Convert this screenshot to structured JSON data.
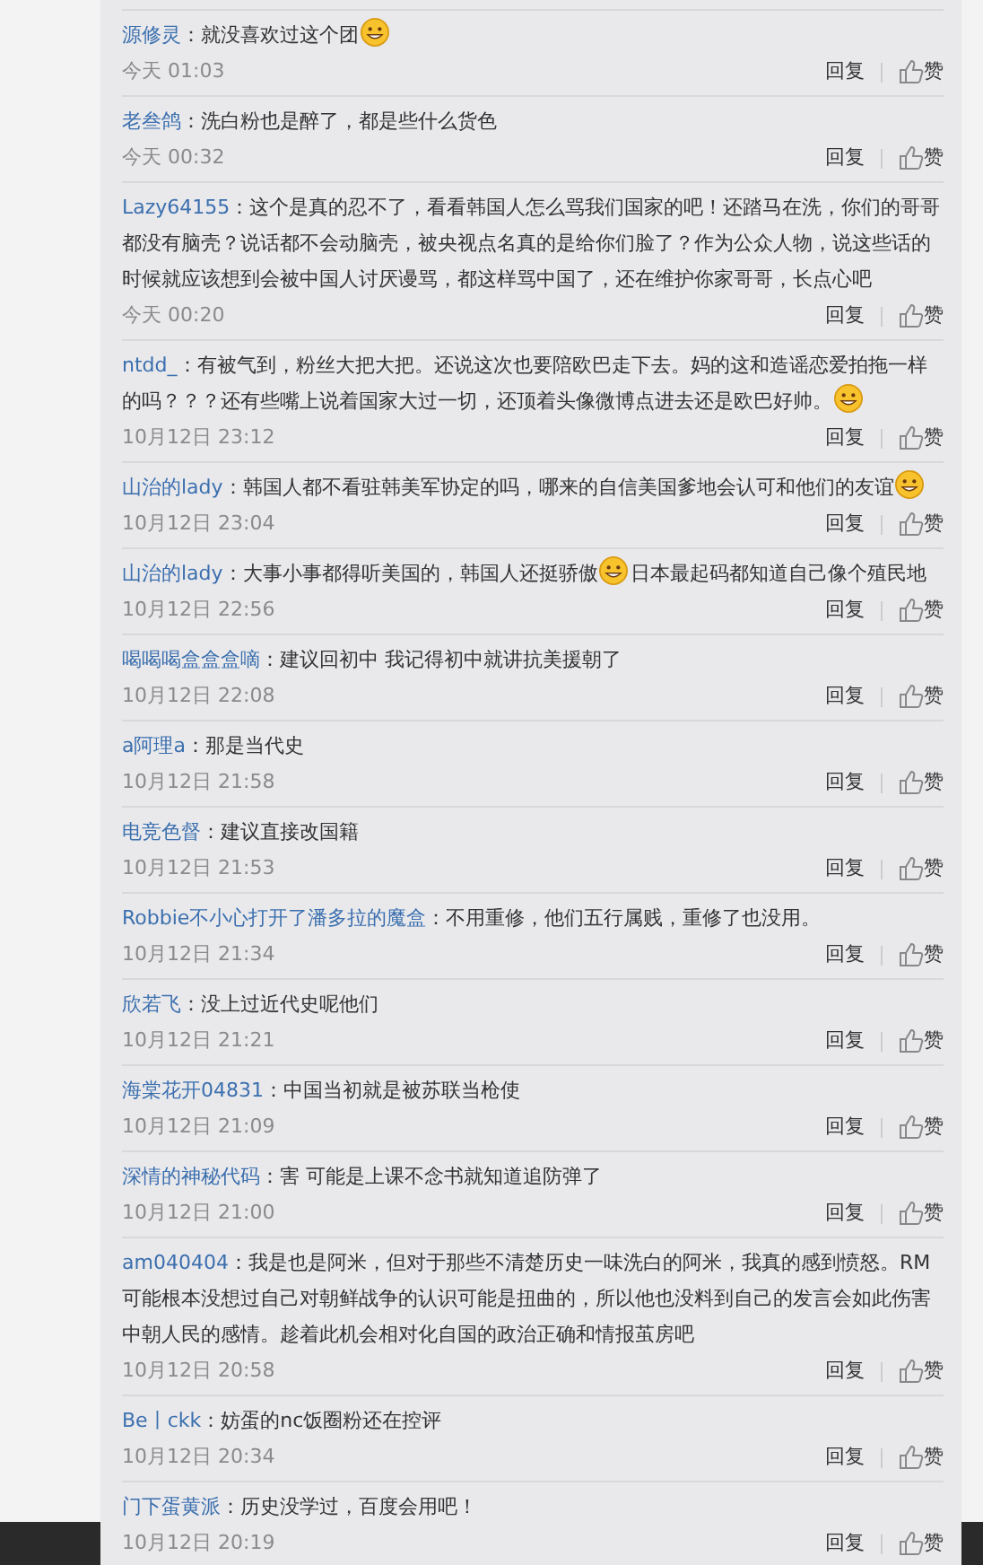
{
  "comments": [
    {
      "user": "源修灵",
      "segments": [
        {
          "kind": "text",
          "text": "：就没喜欢过这个团"
        },
        {
          "kind": "emoji"
        }
      ],
      "time": "今天 01:03",
      "reply": "回复",
      "like": "赞"
    },
    {
      "user": "老叁鸽",
      "segments": [
        {
          "kind": "text",
          "text": "：洗白粉也是醉了，都是些什么货色"
        }
      ],
      "time": "今天 00:32",
      "reply": "回复",
      "like": "赞"
    },
    {
      "user": "Lazy64155",
      "segments": [
        {
          "kind": "text",
          "text": "：这个是真的忍不了，看看韩国人怎么骂我们国家的吧！还踏马在洗，你们的哥哥都没有脑壳？说话都不会动脑壳，被央视点名真的是给你们脸了？作为公众人物，说这些话的时候就应该想到会被中国人讨厌谩骂，都这样骂中国了，还在维护你家哥哥，长点心吧"
        }
      ],
      "time": "今天 00:20",
      "reply": "回复",
      "like": "赞"
    },
    {
      "user": "ntdd_",
      "segments": [
        {
          "kind": "text",
          "text": "：有被气到，粉丝大把大把。还说这次也要陪欧巴走下去。妈的这和造谣恋爱拍拖一样的吗？？？还有些嘴上说着国家大过一切，还顶着头像微博点进去还是欧巴好帅。"
        },
        {
          "kind": "emoji"
        }
      ],
      "time": "10月12日 23:12",
      "reply": "回复",
      "like": "赞"
    },
    {
      "user": "山治的lady",
      "segments": [
        {
          "kind": "text",
          "text": "：韩国人都不看驻韩美军协定的吗，哪来的自信美国爹地会认可和他们的友谊"
        },
        {
          "kind": "emoji"
        }
      ],
      "time": "10月12日 23:04",
      "reply": "回复",
      "like": "赞"
    },
    {
      "user": "山治的lady",
      "segments": [
        {
          "kind": "text",
          "text": "：大事小事都得听美国的，韩国人还挺骄傲"
        },
        {
          "kind": "emoji"
        },
        {
          "kind": "text",
          "text": "日本最起码都知道自己像个殖民地"
        }
      ],
      "time": "10月12日 22:56",
      "reply": "回复",
      "like": "赞"
    },
    {
      "user": "喝喝喝盒盒盒嘀",
      "segments": [
        {
          "kind": "text",
          "text": "：建议回初中 我记得初中就讲抗美援朝了"
        }
      ],
      "time": "10月12日 22:08",
      "reply": "回复",
      "like": "赞"
    },
    {
      "user": "a阿理a",
      "segments": [
        {
          "kind": "text",
          "text": "：那是当代史"
        }
      ],
      "time": "10月12日 21:58",
      "reply": "回复",
      "like": "赞"
    },
    {
      "user": "电竞色督",
      "segments": [
        {
          "kind": "text",
          "text": "：建议直接改国籍"
        }
      ],
      "time": "10月12日 21:53",
      "reply": "回复",
      "like": "赞"
    },
    {
      "user": "Robbie不小心打开了潘多拉的魔盒",
      "segments": [
        {
          "kind": "text",
          "text": "：不用重修，他们五行属贱，重修了也没用。"
        }
      ],
      "time": "10月12日 21:34",
      "reply": "回复",
      "like": "赞"
    },
    {
      "user": "欣若飞",
      "segments": [
        {
          "kind": "text",
          "text": "：没上过近代史呢他们"
        }
      ],
      "time": "10月12日 21:21",
      "reply": "回复",
      "like": "赞"
    },
    {
      "user": "海棠花开04831",
      "segments": [
        {
          "kind": "text",
          "text": "：中国当初就是被苏联当枪使"
        }
      ],
      "time": "10月12日 21:09",
      "reply": "回复",
      "like": "赞"
    },
    {
      "user": "深情的神秘代码",
      "segments": [
        {
          "kind": "text",
          "text": "：害  可能是上课不念书就知道追防弹了"
        }
      ],
      "time": "10月12日 21:00",
      "reply": "回复",
      "like": "赞"
    },
    {
      "user": "am040404",
      "segments": [
        {
          "kind": "text",
          "text": "：我是也是阿米，但对于那些不清楚历史一味洗白的阿米，我真的感到愤怒。RM可能根本没想过自己对朝鲜战争的认识可能是扭曲的，所以他也没料到自己的发言会如此伤害中朝人民的感情。趁着此机会相对化自国的政治正确和情报茧房吧"
        }
      ],
      "time": "10月12日 20:58",
      "reply": "回复",
      "like": "赞"
    },
    {
      "user": "Be丨ckk",
      "segments": [
        {
          "kind": "text",
          "text": "：妨蛋的nc饭圈粉还在控评"
        }
      ],
      "time": "10月12日 20:34",
      "reply": "回复",
      "like": "赞"
    },
    {
      "user": "门下蛋黄派",
      "segments": [
        {
          "kind": "text",
          "text": "：历史没学过，百度会用吧！"
        }
      ],
      "time": "10月12日 20:19",
      "reply": "回复",
      "like": "赞"
    }
  ]
}
